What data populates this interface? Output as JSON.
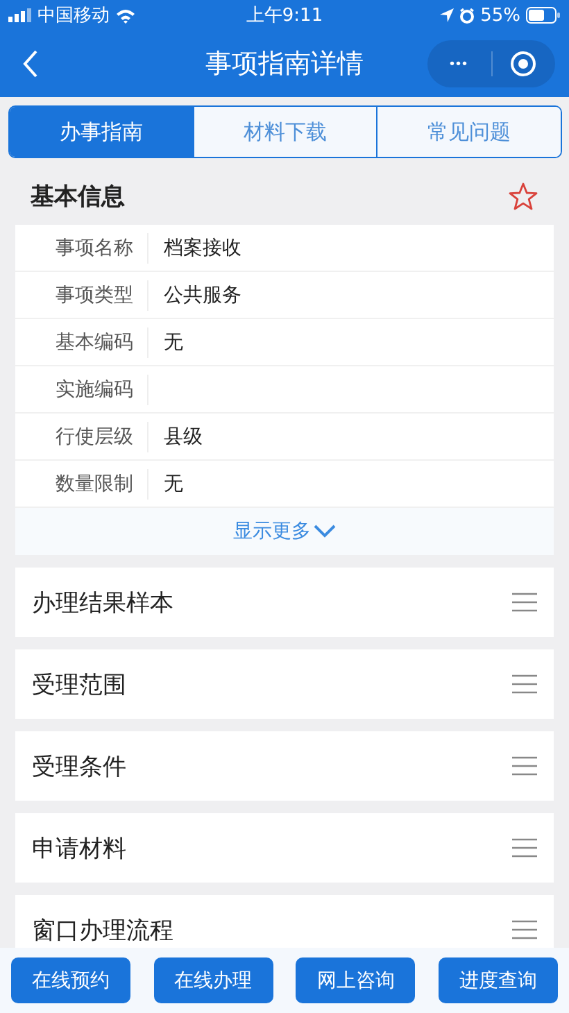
{
  "status_bar": {
    "carrier": "中国移动",
    "time": "上午9:11",
    "battery": "55%"
  },
  "nav": {
    "title": "事项指南详情",
    "more": "•••"
  },
  "tabs": [
    {
      "label": "办事指南",
      "selected": true
    },
    {
      "label": "材料下载",
      "selected": false
    },
    {
      "label": "常见问题",
      "selected": false
    }
  ],
  "basic_info": {
    "title": "基本信息",
    "rows": [
      {
        "label": "事项名称",
        "value": "档案接收"
      },
      {
        "label": "事项类型",
        "value": "公共服务"
      },
      {
        "label": "基本编码",
        "value": "无"
      },
      {
        "label": "实施编码",
        "value": ""
      },
      {
        "label": "行使层级",
        "value": "县级"
      },
      {
        "label": "数量限制",
        "value": "无"
      }
    ],
    "show_more": "显示更多"
  },
  "sections": [
    "办理结果样本",
    "受理范围",
    "受理条件",
    "申请材料",
    "窗口办理流程"
  ],
  "actions": [
    "在线预约",
    "在线办理",
    "网上咨询",
    "进度查询"
  ]
}
